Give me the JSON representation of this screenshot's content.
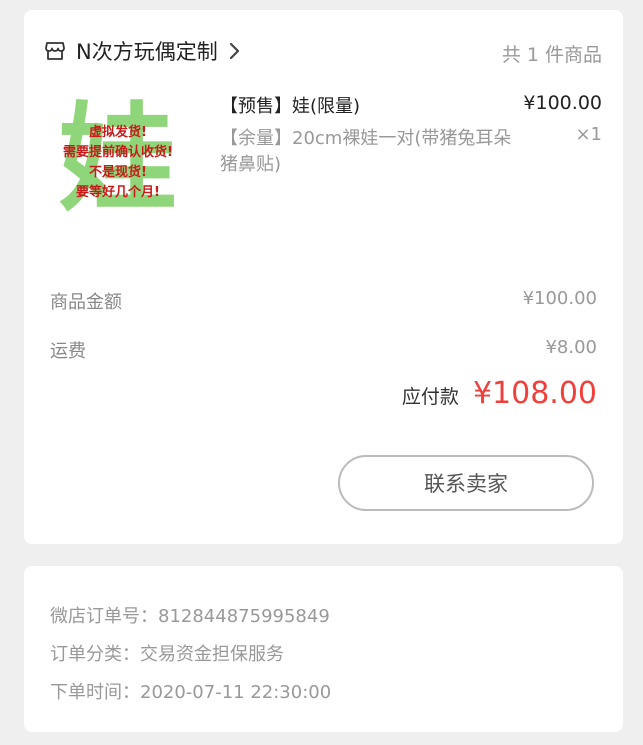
{
  "order": {
    "shop_name": "N次方玩偶定制",
    "item_count_text": "共 1 件商品",
    "product": {
      "thumbnail_big_char": "娃",
      "thumbnail_notes": [
        "虚拟发货!",
        "需要提前确认收货!",
        "不是现货!",
        "要等好几个月!"
      ],
      "title": "【预售】娃(限量)",
      "price": "¥100.00",
      "spec": "【余量】20cm裸娃一对(带猪兔耳朵猪鼻贴)",
      "quantity": "×1"
    },
    "summary": {
      "goods_label": "商品金额",
      "goods_value": "¥100.00",
      "shipping_label": "运费",
      "shipping_value": "¥8.00",
      "payable_label": "应付款",
      "payable_value": "¥108.00"
    },
    "contact_button": "联系卖家"
  },
  "details": {
    "order_no": "微店订单号：812844875995849",
    "category": "订单分类：交易资金担保服务",
    "order_time": "下单时间：2020-07-11 22:30:00"
  },
  "colors": {
    "price_red": "#f0403a",
    "thumbnail_green": "#8fd67a",
    "thumbnail_red": "#c81a1a"
  }
}
